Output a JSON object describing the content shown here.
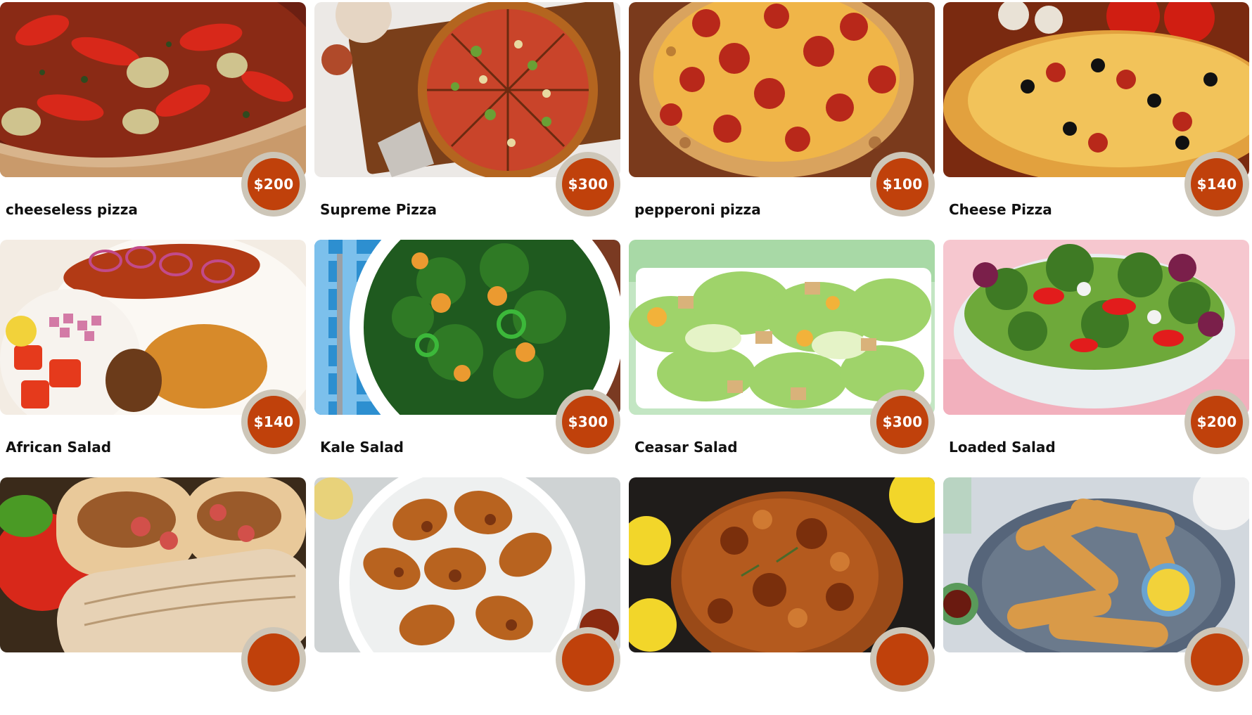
{
  "menu": {
    "items": [
      {
        "name": "cheeseless pizza",
        "price": "$200",
        "image": "pizza-roasted-peppers"
      },
      {
        "name": "Supreme Pizza",
        "price": "$300",
        "image": "pizza-supreme-sliced"
      },
      {
        "name": "pepperoni pizza",
        "price": "$100",
        "image": "pizza-pepperoni"
      },
      {
        "name": "Cheese Pizza",
        "price": "$140",
        "image": "pizza-cheese-olives"
      },
      {
        "name": "African Salad",
        "price": "$140",
        "image": "salad-african-fish"
      },
      {
        "name": "Kale Salad",
        "price": "$300",
        "image": "salad-kale"
      },
      {
        "name": "Ceasar Salad",
        "price": "$300",
        "image": "salad-caesar"
      },
      {
        "name": "Loaded Salad",
        "price": "$200",
        "image": "salad-loaded-bowl"
      },
      {
        "name": "",
        "price": "",
        "image": "wraps-shawarma"
      },
      {
        "name": "",
        "price": "",
        "image": "chicken-wings"
      },
      {
        "name": "",
        "price": "",
        "image": "roast-chicken"
      },
      {
        "name": "",
        "price": "",
        "image": "chicken-tenders"
      }
    ]
  },
  "colors": {
    "price_badge": "#c0410b",
    "price_ring": "#cdc6b8",
    "text": "#111111"
  }
}
